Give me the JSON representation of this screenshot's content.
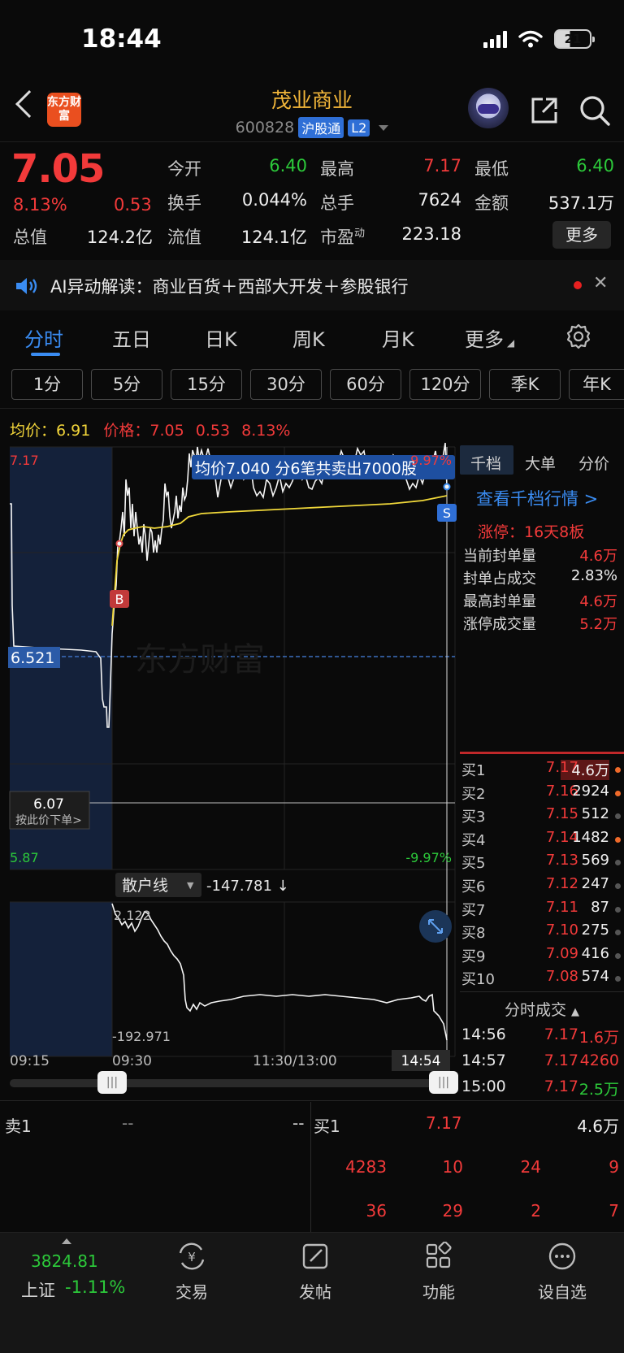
{
  "status": {
    "time": "18:44",
    "battery": "21"
  },
  "header": {
    "stock_name": "茂业商业",
    "stock_code": "600828",
    "tag_hgt": "沪股通",
    "tag_l2": "L2",
    "logo_text": "东方财富"
  },
  "quote": {
    "price": "7.05",
    "change_pct": "8.13%",
    "change_amt": "0.53",
    "open_label": "今开",
    "open": "6.40",
    "high_label": "最高",
    "high": "7.17",
    "low_label": "最低",
    "low": "6.40",
    "turnover_label": "换手",
    "turnover": "0.044%",
    "volume_label": "总手",
    "volume": "7624",
    "amount_label": "金额",
    "amount": "537.1万",
    "mktcap_label": "总值",
    "mktcap": "124.2亿",
    "float_label": "流值",
    "float_cap": "124.1亿",
    "pe_label": "市盈",
    "pe_sup": "动",
    "pe": "223.18",
    "more": "更多"
  },
  "ai": {
    "text": "AI异动解读：商业百货＋西部大开发＋参股银行",
    "close": "✕"
  },
  "tabs": [
    "分时",
    "五日",
    "日K",
    "周K",
    "月K",
    "更多"
  ],
  "periods": [
    "1分",
    "5分",
    "15分",
    "30分",
    "60分",
    "120分",
    "季K",
    "年K"
  ],
  "legend": {
    "avg_label": "均价：",
    "avg": "6.91",
    "price_label": "价格：",
    "price": "7.05",
    "chg": "0.53",
    "pct": "8.13%"
  },
  "chart": {
    "y_top": "7.17",
    "y_bottom": "5.87",
    "pct_top": "9.97%",
    "pct_bottom": "-9.97%",
    "ref_price": "6.521",
    "order_price": "6.07",
    "order_hint": "按此价下单>",
    "annotation": "均价7.040  分6笔共卖出7000股",
    "watermark": "东方财富",
    "marker_b": "B",
    "marker_s": "S",
    "indicator_name": "散户线",
    "indicator_value": "-147.781 ↓",
    "ind_top": "2.122",
    "ind_bottom": "-192.971",
    "x_labels": [
      "09:15",
      "09:30",
      "11:30/13:00"
    ],
    "x_cursor": "14:54"
  },
  "right_panel": {
    "tabs": [
      "千档",
      "大单",
      "分价"
    ],
    "link": "查看千档行情 >",
    "limit": "涨停：16天8板",
    "stats": [
      {
        "k": "当前封单量",
        "v": "4.6万"
      },
      {
        "k": "封单占成交",
        "v": "2.83%"
      },
      {
        "k": "最高封单量",
        "v": "4.6万"
      },
      {
        "k": "涨停成交量",
        "v": "5.2万"
      }
    ],
    "bids": [
      {
        "label": "买1",
        "price": "7.17",
        "vol": "4.6万",
        "dot": true
      },
      {
        "label": "买2",
        "price": "7.16",
        "vol": "2924",
        "dot": true
      },
      {
        "label": "买3",
        "price": "7.15",
        "vol": "512",
        "dot": false
      },
      {
        "label": "买4",
        "price": "7.14",
        "vol": "1482",
        "dot": true
      },
      {
        "label": "买5",
        "price": "7.13",
        "vol": "569",
        "dot": false
      },
      {
        "label": "买6",
        "price": "7.12",
        "vol": "247",
        "dot": false
      },
      {
        "label": "买7",
        "price": "7.11",
        "vol": "87",
        "dot": false
      },
      {
        "label": "买8",
        "price": "7.10",
        "vol": "275",
        "dot": false
      },
      {
        "label": "买9",
        "price": "7.09",
        "vol": "416",
        "dot": false
      },
      {
        "label": "买10",
        "price": "7.08",
        "vol": "574",
        "dot": false
      }
    ],
    "fs_title": "分时成交",
    "trades": [
      {
        "t": "14:56",
        "p": "7.17",
        "v": "1.6万",
        "c": "#f23a3a"
      },
      {
        "t": "14:57",
        "p": "7.17",
        "v": "4260",
        "c": "#f23a3a"
      },
      {
        "t": "15:00",
        "p": "7.17",
        "v": "2.5万",
        "c": "#2cc93a"
      }
    ]
  },
  "book": {
    "sell1_label": "卖1",
    "sell1_price": "--",
    "sell1_vol": "--",
    "buy1_label": "买1",
    "buy1_price": "7.17",
    "buy1_vol": "4.6万",
    "row1": [
      "4283",
      "10",
      "24",
      "9"
    ],
    "row2": [
      "36",
      "29",
      "2",
      "7"
    ]
  },
  "nav": {
    "index_value": "3824.81",
    "index_name": "上证",
    "index_pct": "-1.11%",
    "items": [
      "交易",
      "发帖",
      "功能",
      "设自选"
    ]
  }
}
